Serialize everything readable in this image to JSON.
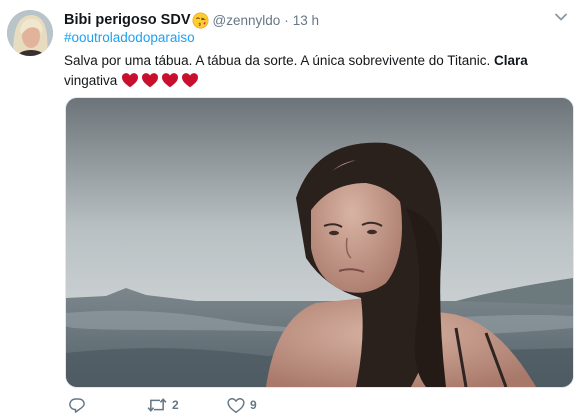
{
  "tweet": {
    "author": {
      "display_name": "Bibi perigoso SDV",
      "emoji": "kissing-face-emoji",
      "handle": "@zennyldo",
      "separator": "·",
      "timestamp": "13 h"
    },
    "hashtag": "#ooutroladodoparaiso",
    "text": {
      "main": "Salva por uma tábua. A tábua da sorte. A única sobrevivente do Titanic. ",
      "bold": "Clara",
      "end": " vingativa",
      "hearts_count": 4,
      "heart_color": "#c8102e"
    },
    "media": {
      "icon": "photo"
    },
    "actions": {
      "reply_icon": "reply-icon",
      "retweet_count": "2",
      "like_count": "9"
    },
    "colors": {
      "link": "#1da1f2",
      "secondary_text": "#657786",
      "border": "#e1e8ed"
    }
  }
}
